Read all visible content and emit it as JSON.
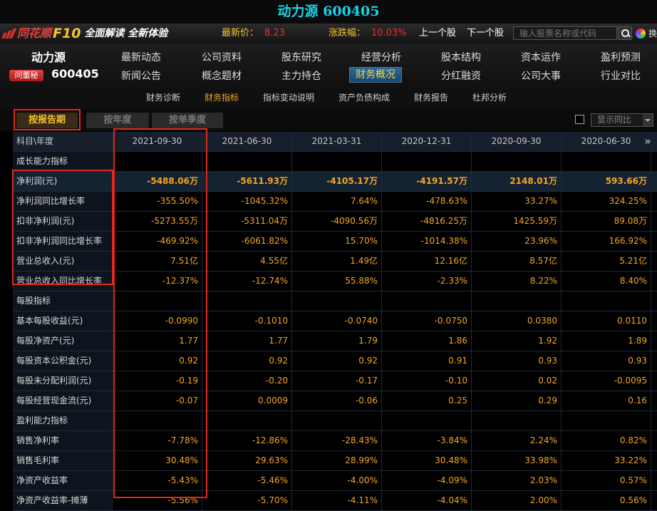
{
  "window": {
    "title": "动力源 600405"
  },
  "topbar": {
    "brand": "同花顺",
    "product": "F10",
    "slogan": "全面解读 全新体验",
    "price_label": "最新价：",
    "price_value": "8.23",
    "change_label": "涨跌幅：",
    "change_value": "10.03%",
    "prev_label": "上一个股",
    "next_label": "下一个股",
    "search_placeholder": "输入股票名称或代码",
    "swap_label": "换"
  },
  "stock": {
    "name": "动力源",
    "code": "600405",
    "dongmi_label": "问董秘"
  },
  "nav": {
    "row1": [
      "最新动态",
      "公司资料",
      "股东研究",
      "经营分析",
      "股本结构",
      "资本运作",
      "盈利预测"
    ],
    "row2": [
      "新闻公告",
      "概念题材",
      "主力持仓",
      "财务概况",
      "分红融资",
      "公司大事",
      "行业对比"
    ],
    "active": "财务概况"
  },
  "subnav": {
    "items": [
      "财务诊断",
      "财务指标",
      "指标变动说明",
      "资产负债构成",
      "财务报告",
      "杜邦分析"
    ],
    "active": "财务指标"
  },
  "tabs": {
    "items": [
      "按报告期",
      "按年度",
      "按单季度"
    ],
    "active": "按报告期",
    "show_yoy_label": "显示同比"
  },
  "colors": {
    "accent": "#f5a623",
    "highlight_box": "#e0281e",
    "title": "#19d3e8"
  },
  "table": {
    "header_label": "科目\\年度",
    "columns": [
      "2021-09-30",
      "2021-06-30",
      "2021-03-31",
      "2020-12-31",
      "2020-09-30",
      "2020-06-30"
    ],
    "rows": [
      {
        "label": "成长能力指标",
        "section": true,
        "values": []
      },
      {
        "label": "净利润(元)",
        "bold": true,
        "values": [
          "-5488.06万",
          "-5611.93万",
          "-4105.17万",
          "-4191.57万",
          "2148.01万",
          "593.66万"
        ]
      },
      {
        "label": "净利润同比增长率",
        "values": [
          "-355.50%",
          "-1045.32%",
          "7.64%",
          "-478.63%",
          "33.27%",
          "324.25%"
        ]
      },
      {
        "label": "扣非净利润(元)",
        "values": [
          "-5273.55万",
          "-5311.04万",
          "-4090.56万",
          "-4816.25万",
          "1425.59万",
          "89.08万"
        ]
      },
      {
        "label": "扣非净利润同比增长率",
        "values": [
          "-469.92%",
          "-6061.82%",
          "15.70%",
          "-1014.38%",
          "23.96%",
          "166.92%"
        ]
      },
      {
        "label": "营业总收入(元)",
        "values": [
          "7.51亿",
          "4.55亿",
          "1.49亿",
          "12.16亿",
          "8.57亿",
          "5.21亿"
        ]
      },
      {
        "label": "营业总收入同比增长率",
        "values": [
          "-12.37%",
          "-12.74%",
          "55.88%",
          "-2.33%",
          "8.22%",
          "8.40%"
        ]
      },
      {
        "label": "每股指标",
        "section": true,
        "values": []
      },
      {
        "label": "基本每股收益(元)",
        "values": [
          "-0.0990",
          "-0.1010",
          "-0.0740",
          "-0.0750",
          "0.0380",
          "0.0110"
        ]
      },
      {
        "label": "每股净资产(元)",
        "values": [
          "1.77",
          "1.77",
          "1.79",
          "1.86",
          "1.92",
          "1.89"
        ]
      },
      {
        "label": "每股资本公积金(元)",
        "values": [
          "0.92",
          "0.92",
          "0.92",
          "0.91",
          "0.93",
          "0.93"
        ]
      },
      {
        "label": "每股未分配利润(元)",
        "values": [
          "-0.19",
          "-0.20",
          "-0.17",
          "-0.10",
          "0.02",
          "-0.0095"
        ]
      },
      {
        "label": "每股经营现金流(元)",
        "values": [
          "-0.07",
          "0.0009",
          "-0.06",
          "0.25",
          "0.29",
          "0.16"
        ]
      },
      {
        "label": "盈利能力指标",
        "section": true,
        "values": []
      },
      {
        "label": "销售净利率",
        "values": [
          "-7.78%",
          "-12.86%",
          "-28.43%",
          "-3.84%",
          "2.24%",
          "0.82%"
        ]
      },
      {
        "label": "销售毛利率",
        "values": [
          "30.48%",
          "29.63%",
          "28.99%",
          "30.48%",
          "33.98%",
          "33.22%"
        ]
      },
      {
        "label": "净资产收益率",
        "values": [
          "-5.43%",
          "-5.46%",
          "-4.00%",
          "-4.09%",
          "2.03%",
          "0.57%"
        ]
      },
      {
        "label": "净资产收益率-摊薄",
        "values": [
          "-5.56%",
          "-5.70%",
          "-4.11%",
          "-4.04%",
          "2.00%",
          "0.56%"
        ]
      }
    ]
  }
}
